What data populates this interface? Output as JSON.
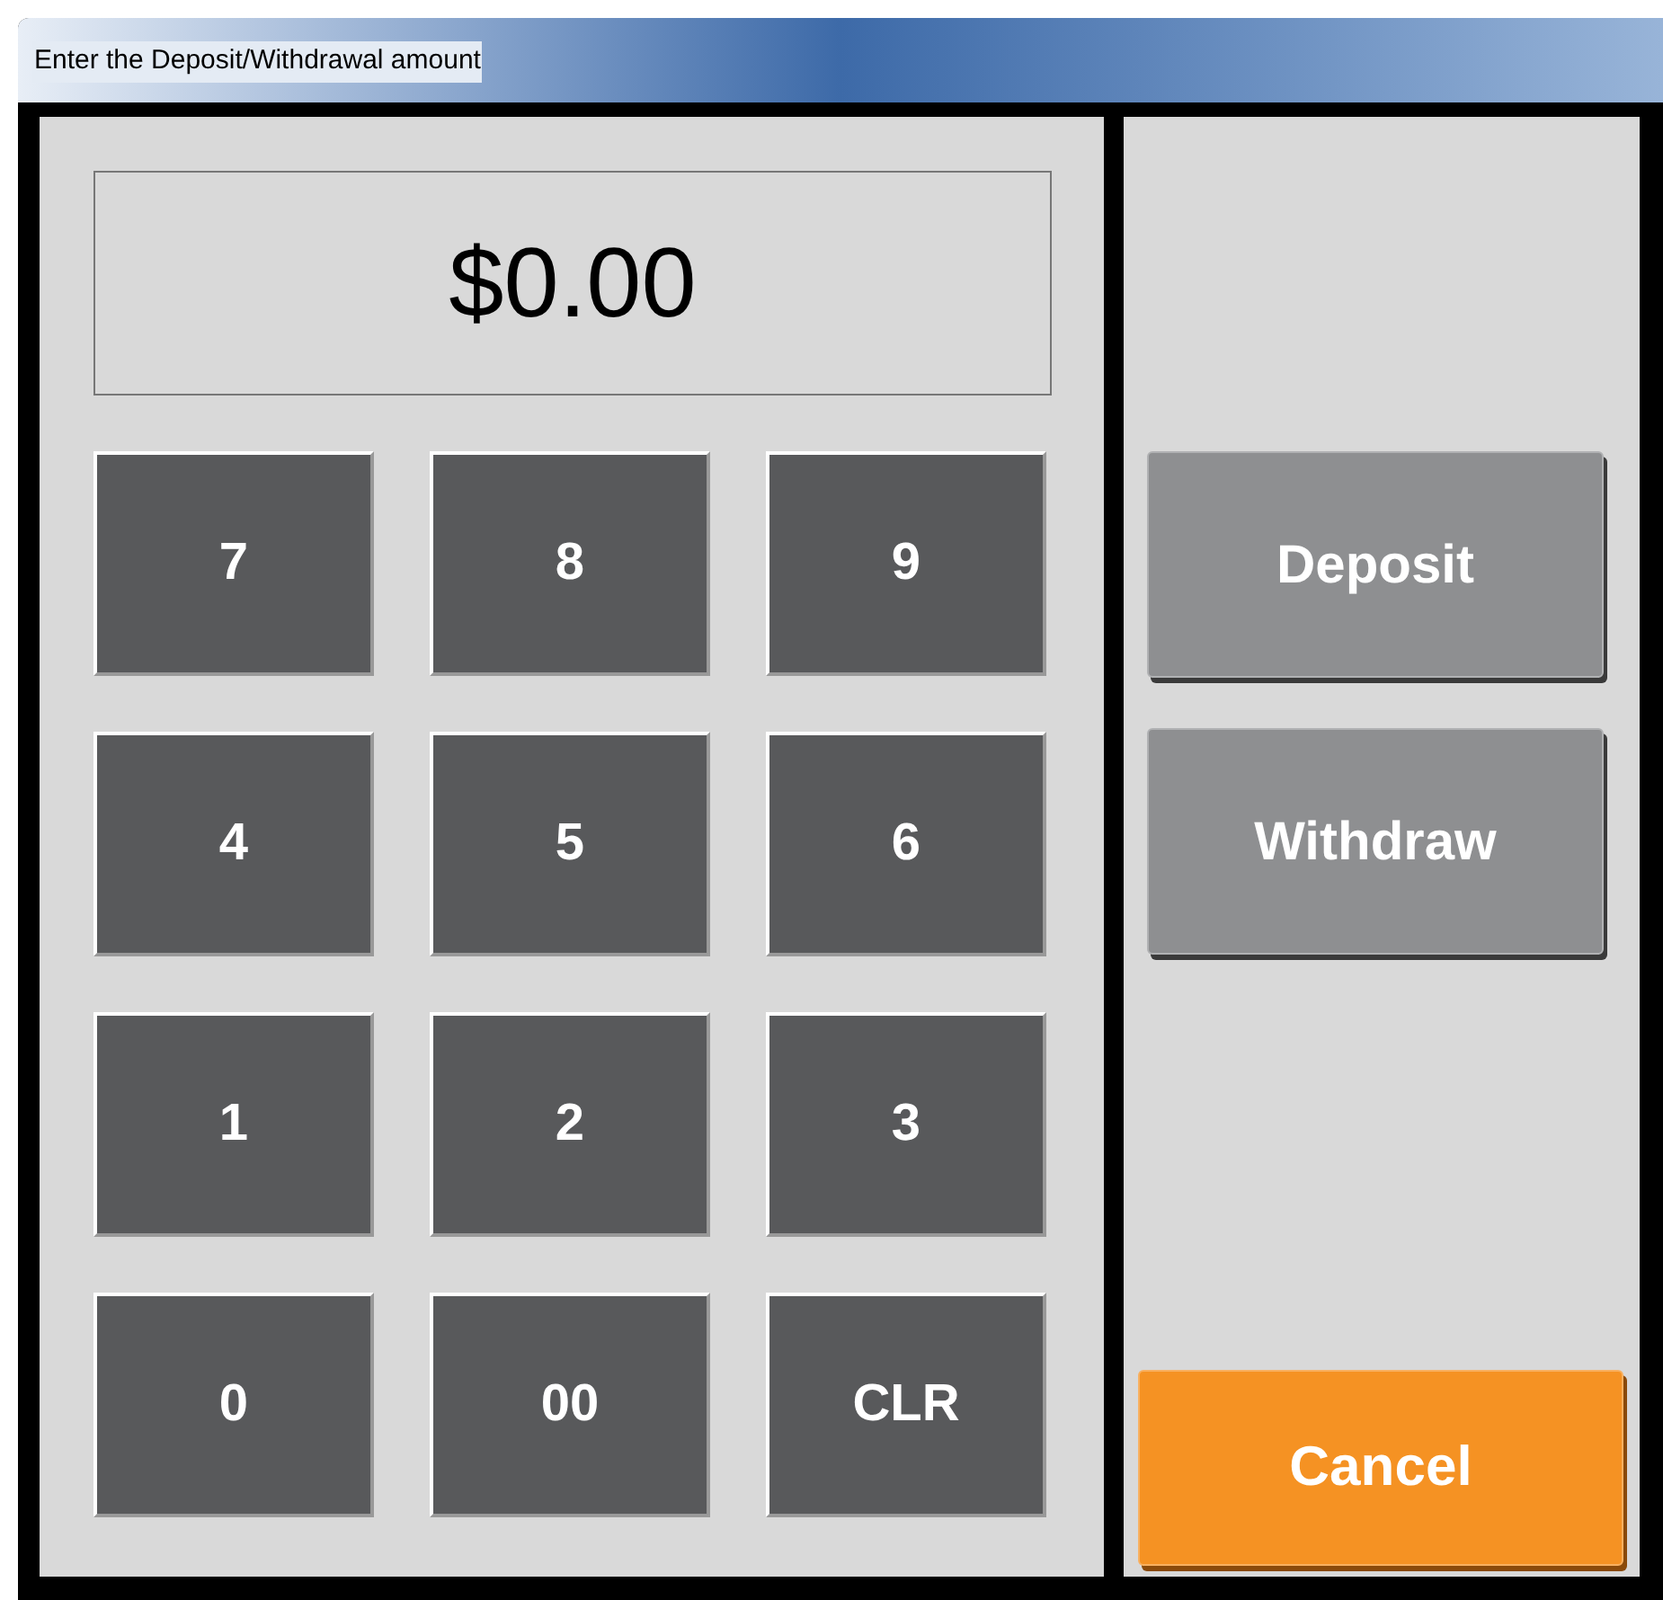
{
  "window": {
    "title": "Enter the Deposit/Withdrawal amount"
  },
  "display": {
    "value": "$0.00"
  },
  "keys": [
    "7",
    "8",
    "9",
    "4",
    "5",
    "6",
    "1",
    "2",
    "3",
    "0",
    "00",
    "CLR"
  ],
  "actions": [
    {
      "label": "Deposit",
      "kind": "primary"
    },
    {
      "label": "Withdraw",
      "kind": "primary"
    },
    {
      "label": "Cancel",
      "kind": "cancel"
    }
  ]
}
